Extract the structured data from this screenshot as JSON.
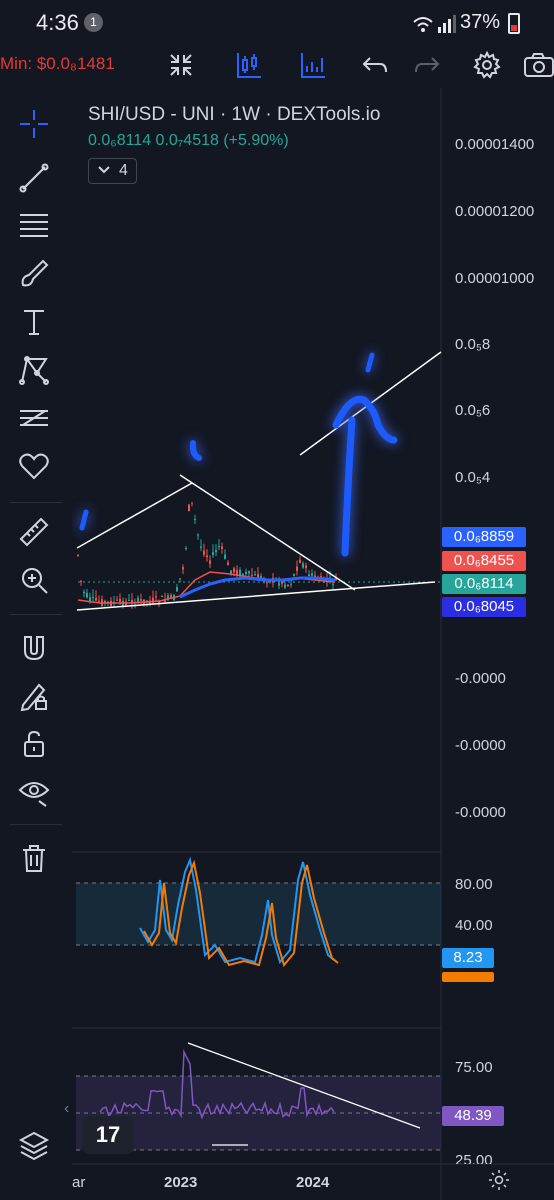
{
  "status_bar": {
    "time": "4:36",
    "notification_count": "1",
    "battery": "37%"
  },
  "toolbar": {
    "min_label": "Min: $0.0₈1481"
  },
  "legend": {
    "title": "SHI/USD - UNI · 1W · DEXTools.io",
    "ohlc": "0.0₆8114  0.0₇4518 (+5.90%)",
    "indicator_count": "4"
  },
  "price_axis": {
    "labels": [
      "0.00001400",
      "0.00001200",
      "0.00001000",
      "0.0₅8",
      "0.0₅6",
      "0.0₅4",
      "-0.0000",
      "-0.0000",
      "-0.0000"
    ]
  },
  "price_tags": [
    {
      "label": "0.0₆8859",
      "color": "#2962ff"
    },
    {
      "label": "0.0₆8455",
      "color": "#ef5350"
    },
    {
      "label": "0.0₆8114",
      "color": "#26a69a"
    },
    {
      "label": "0.0₆8045",
      "color": "#2a2ee0"
    }
  ],
  "stoch_panel": {
    "labels": [
      "80.00",
      "40.00"
    ],
    "value": "8.23",
    "value_color": "#2196f3",
    "second_color": "#f57c00"
  },
  "rsi_panel": {
    "labels": [
      "75.00",
      "25.00"
    ],
    "value": "48.39",
    "value_color": "#7e57c2"
  },
  "time_axis": {
    "labels": [
      "ar",
      "2023",
      "2024"
    ]
  },
  "watermark": "17",
  "colors": {
    "background": "#131722",
    "candle_up": "#26a69a",
    "candle_down": "#ef5350",
    "ma_blue": "#2962ff",
    "ma_red": "#ef5350",
    "annotation": "#1e5bff",
    "rsi_line": "#7e57c2"
  }
}
